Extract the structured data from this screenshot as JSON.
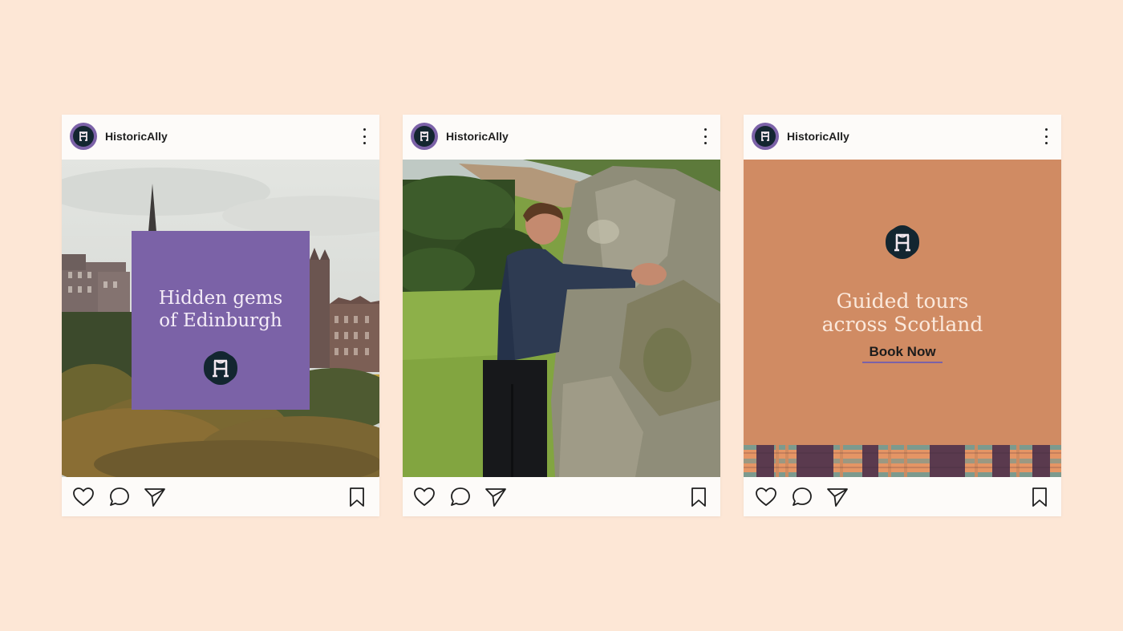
{
  "posts": [
    {
      "username": "HistoricAlly",
      "title_line1": "Hidden gems",
      "title_line2": "of Edinburgh"
    },
    {
      "username": "HistoricAlly"
    },
    {
      "username": "HistoricAlly",
      "title_line1": "Guided tours",
      "title_line2": "across Scotland",
      "cta_label": "Book Now"
    }
  ],
  "colors": {
    "background": "#fde7d6",
    "brand_purple": "#7b62a7",
    "brand_navy": "#132630",
    "orange_panel": "#d08b63"
  },
  "icons": {
    "avatar": "historically-logo-icon",
    "more": "more-vertical-icon",
    "like": "heart-icon",
    "comment": "comment-icon",
    "share": "send-icon",
    "save": "bookmark-icon"
  }
}
